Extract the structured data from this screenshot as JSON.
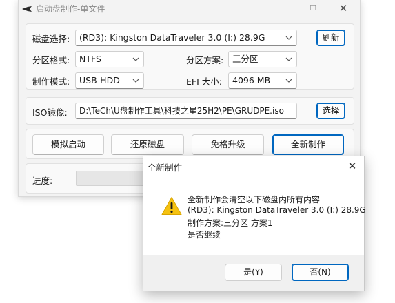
{
  "main_window": {
    "title": "启动盘制作-单文件",
    "controls": {
      "minimize": "—",
      "maximize": "☐",
      "close": "✕"
    }
  },
  "disk_section": {
    "disk_label": "磁盘选择:",
    "disk_value": "(RD3): Kingston DataTraveler 3.0 (I:) 28.9G",
    "refresh_button": "刷新",
    "fs_label": "分区格式:",
    "fs_value": "NTFS",
    "scheme_label": "分区方案:",
    "scheme_value": "三分区",
    "mode_label": "制作模式:",
    "mode_value": "USB-HDD",
    "efi_label": "EFI 大小:",
    "efi_value": "4096 MB"
  },
  "iso_section": {
    "label": "ISO镜像:",
    "path": "D:\\TeCh\\U盘制作工具\\科技之星25H2\\PE\\GRUDPE.iso",
    "select_button": "选择"
  },
  "actions": {
    "simulate": "模拟启动",
    "restore": "还原磁盘",
    "upgrade": "免格升级",
    "new_make": "全新制作"
  },
  "progress": {
    "label": "进度:",
    "value": 0
  },
  "dialog": {
    "title": "全新制作",
    "close": "✕",
    "message_lines": [
      "全新制作会清空以下磁盘内所有内容",
      "(RD3): Kingston DataTraveler 3.0 (I:) 28.9G",
      "制作方案:三分区 方案1",
      "是否继续"
    ],
    "yes_button": "是(Y)",
    "no_button": "否(N)"
  },
  "colors": {
    "accent": "#0067c0",
    "warning": "#f5c211"
  },
  "icons": [
    "app-icon",
    "chevron-down-icon",
    "warning-icon",
    "close-icon"
  ]
}
